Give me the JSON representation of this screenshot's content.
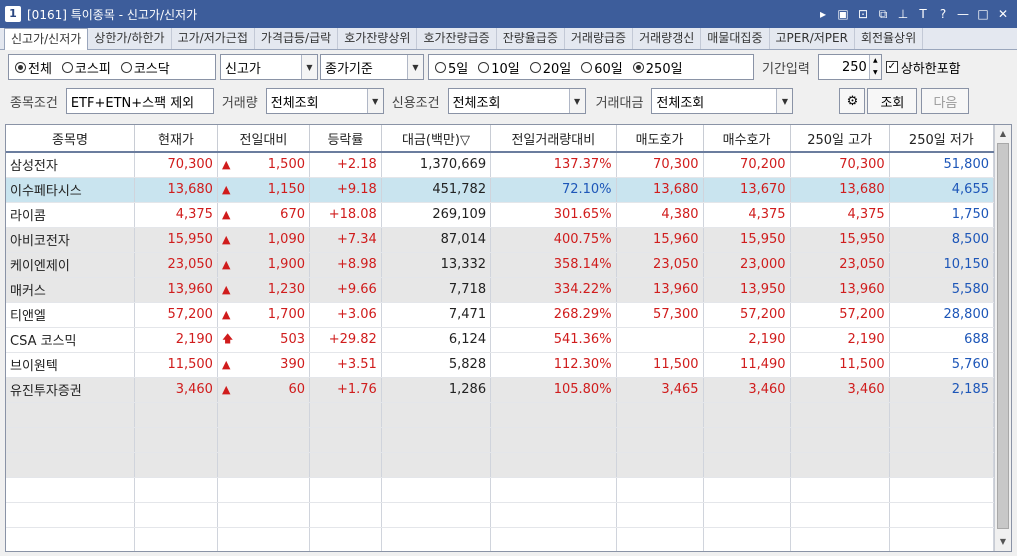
{
  "window": {
    "number": "1",
    "title": "[0161] 특이종목 - 신고가/신저가",
    "controls": [
      "▸",
      "▣",
      "⊡",
      "⧉",
      "⊥",
      "T",
      "?",
      "—",
      "□",
      "✕"
    ]
  },
  "tabs": [
    {
      "label": "신고가/신저가",
      "active": true
    },
    {
      "label": "상한가/하한가"
    },
    {
      "label": "고가/저가근접"
    },
    {
      "label": "가격급등/급락"
    },
    {
      "label": "호가잔량상위"
    },
    {
      "label": "호가잔량급증"
    },
    {
      "label": "잔량율급증"
    },
    {
      "label": "거래량급증"
    },
    {
      "label": "거래량갱신"
    },
    {
      "label": "매물대집중"
    },
    {
      "label": "고PER/저PER"
    },
    {
      "label": "회전율상위"
    }
  ],
  "filters": {
    "market_radios": [
      {
        "label": "전체",
        "checked": true
      },
      {
        "label": "코스피",
        "checked": false
      },
      {
        "label": "코스닥",
        "checked": false
      }
    ],
    "high_low_select": "신고가",
    "basis_select": "종가기준",
    "period_radios": [
      {
        "label": "5일",
        "checked": false
      },
      {
        "label": "10일",
        "checked": false
      },
      {
        "label": "20일",
        "checked": false
      },
      {
        "label": "60일",
        "checked": false
      },
      {
        "label": "250일",
        "checked": true
      }
    ],
    "period_input_label": "기간입력",
    "period_input_value": "250",
    "include_limit_label": "상하한포함",
    "include_limit_checked": true,
    "stock_condition_label": "종목조건",
    "stock_condition_value": "ETF+ETN+스팩 제외",
    "volume_label": "거래량",
    "volume_value": "전체조회",
    "credit_label": "신용조건",
    "credit_value": "전체조회",
    "amount_label": "거래대금",
    "amount_value": "전체조회",
    "query_button": "조회",
    "next_button": "다음"
  },
  "table": {
    "headers": [
      "종목명",
      "현재가",
      "전일대비",
      "등락률",
      "대금(백만)▽",
      "전일거래량대비",
      "매도호가",
      "매수호가",
      "250일 고가",
      "250일 저가"
    ],
    "rows": [
      {
        "name": "삼성전자",
        "price": "70,300",
        "change_icon": "▲",
        "change": "1,500",
        "rate": "+2.18",
        "amount": "1,370,669",
        "vol_ratio": "137.37%",
        "ask": "70,300",
        "bid": "70,200",
        "high": "70,300",
        "low": "51,800"
      },
      {
        "name": "이수페타시스",
        "price": "13,680",
        "change_icon": "▲",
        "change": "1,150",
        "rate": "+9.18",
        "amount": "451,782",
        "vol_ratio": "72.10%",
        "ask": "13,680",
        "bid": "13,670",
        "high": "13,680",
        "low": "4,655"
      },
      {
        "name": "라이콤",
        "price": "4,375",
        "change_icon": "▲",
        "change": "670",
        "rate": "+18.08",
        "amount": "269,109",
        "vol_ratio": "301.65%",
        "ask": "4,380",
        "bid": "4,375",
        "high": "4,375",
        "low": "1,750"
      },
      {
        "name": "아비코전자",
        "price": "15,950",
        "change_icon": "▲",
        "change": "1,090",
        "rate": "+7.34",
        "amount": "87,014",
        "vol_ratio": "400.75%",
        "ask": "15,960",
        "bid": "15,950",
        "high": "15,950",
        "low": "8,500"
      },
      {
        "name": "케이엔제이",
        "price": "23,050",
        "change_icon": "▲",
        "change": "1,900",
        "rate": "+8.98",
        "amount": "13,332",
        "vol_ratio": "358.14%",
        "ask": "23,050",
        "bid": "23,000",
        "high": "23,050",
        "low": "10,150"
      },
      {
        "name": "매커스",
        "price": "13,960",
        "change_icon": "▲",
        "change": "1,230",
        "rate": "+9.66",
        "amount": "7,718",
        "vol_ratio": "334.22%",
        "ask": "13,960",
        "bid": "13,950",
        "high": "13,960",
        "low": "5,580"
      },
      {
        "name": "티앤엘",
        "price": "57,200",
        "change_icon": "▲",
        "change": "1,700",
        "rate": "+3.06",
        "amount": "7,471",
        "vol_ratio": "268.29%",
        "ask": "57,300",
        "bid": "57,200",
        "high": "57,200",
        "low": "28,800"
      },
      {
        "name": "CSA 코스믹",
        "price": "2,190",
        "change_icon": "🡅",
        "change": "503",
        "rate": "+29.82",
        "amount": "6,124",
        "vol_ratio": "541.36%",
        "ask": "",
        "bid": "2,190",
        "high": "2,190",
        "low": "688"
      },
      {
        "name": "브이원텍",
        "price": "11,500",
        "change_icon": "▲",
        "change": "390",
        "rate": "+3.51",
        "amount": "5,828",
        "vol_ratio": "112.30%",
        "ask": "11,500",
        "bid": "11,490",
        "high": "11,500",
        "low": "5,760"
      },
      {
        "name": "유진투자증권",
        "price": "3,460",
        "change_icon": "▲",
        "change": "60",
        "rate": "+1.76",
        "amount": "1,286",
        "vol_ratio": "105.80%",
        "ask": "3,465",
        "bid": "3,460",
        "high": "3,460",
        "low": "2,185"
      }
    ]
  }
}
